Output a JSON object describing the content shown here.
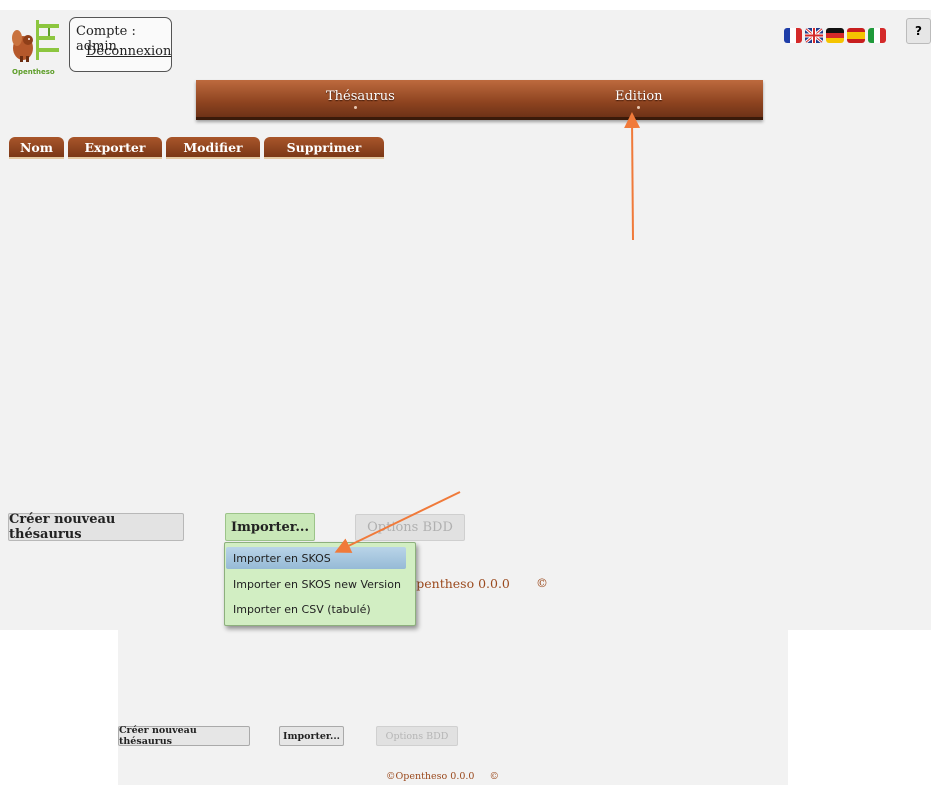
{
  "header": {
    "account_label": "Compte : admin",
    "logout_label": "Déconnexion",
    "logo_text": "Opentheso",
    "help_label": "?",
    "flags": [
      "french-flag-icon",
      "uk-flag-icon",
      "german-flag-icon",
      "spanish-flag-icon",
      "italian-flag-icon"
    ]
  },
  "menu": {
    "items": [
      "Thésaurus",
      "Edition"
    ]
  },
  "tabs": [
    "Nom",
    "Exporter",
    "Modifier",
    "Supprimer"
  ],
  "actions": {
    "create_label": "Créer nouveau thésaurus",
    "import_label": "Importer...",
    "options_label": "Options BDD"
  },
  "import_menu": {
    "items": [
      "Importer en SKOS",
      "Importer en SKOS new Version",
      "Importer en CSV (tabulé)"
    ],
    "active_index": 0
  },
  "footer": {
    "text": "©Opentheso 0.0.0",
    "visible_text": "Opentheso 0.0.0",
    "symbol": "©"
  },
  "second_view": {
    "create_label": "Créer nouveau thésaurus",
    "import_label": "Importer...",
    "options_label": "Options BDD",
    "footer_text": "©Opentheso 0.0.0     ©"
  },
  "colors": {
    "menu_brown": "#8e4420",
    "tab_brown": "#7a3716",
    "import_green": "#c9e8b8",
    "annotation_arrow": "#f07a3a",
    "footer_text": "#9b4a1e"
  }
}
